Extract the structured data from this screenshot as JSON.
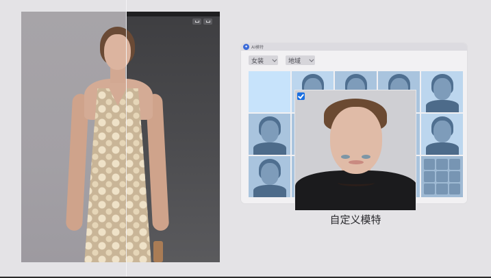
{
  "photo_panel": {
    "toolbar_icons": [
      "image-icon",
      "chevron-down-icon"
    ]
  },
  "app_window": {
    "title": "AI模特",
    "logo_icon": "app-logo-icon",
    "filters": [
      {
        "label": "女装",
        "icon": "chevron-down-icon"
      },
      {
        "label": "地域",
        "icon": "chevron-down-icon"
      }
    ],
    "grid_tiles": 15
  },
  "featured": {
    "selected": true,
    "caption": "自定义模特"
  },
  "colors": {
    "background": "#e4e3e6",
    "checkbox": "#1b6fe0",
    "grid_tint": "#a9c4de"
  }
}
